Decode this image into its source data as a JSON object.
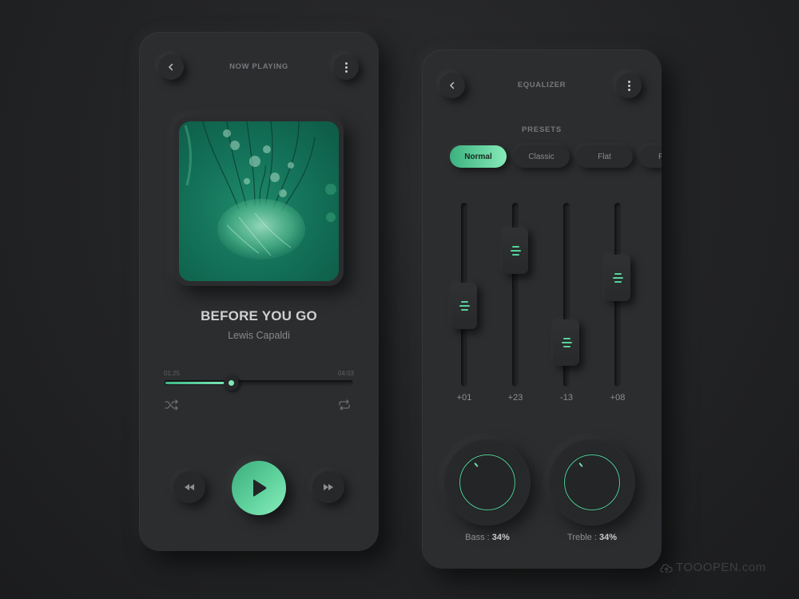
{
  "player": {
    "header_title": "NOW PLAYING",
    "back_icon": "chevron-left-icon",
    "menu_icon": "more-vertical-icon",
    "album_art": "jellyfish-album-art",
    "song_title": "BEFORE YOU GO",
    "artist": "Lewis Capaldi",
    "elapsed": "01:25",
    "duration": "04:03",
    "progress_fraction": 0.35,
    "shuffle_icon": "shuffle-icon",
    "repeat_icon": "repeat-icon",
    "controls": {
      "rewind_icon": "rewind-icon",
      "play_icon": "play-icon",
      "forward_icon": "fast-forward-icon"
    }
  },
  "equalizer": {
    "header_title": "EQUALIZER",
    "back_icon": "chevron-left-icon",
    "menu_icon": "more-vertical-icon",
    "presets_label": "PRESETS",
    "presets": [
      {
        "label": "Normal",
        "active": true
      },
      {
        "label": "Classic",
        "active": false
      },
      {
        "label": "Flat",
        "active": false
      },
      {
        "label": "P",
        "active": false
      }
    ],
    "bands": [
      {
        "value_label": "+01",
        "level": 0.44
      },
      {
        "value_label": "+23",
        "level": 0.74
      },
      {
        "value_label": "-13",
        "level": 0.24
      },
      {
        "value_label": "+08",
        "level": 0.59
      }
    ],
    "dials": [
      {
        "name": "Bass",
        "value": "34%"
      },
      {
        "name": "Treble",
        "value": "34%"
      }
    ],
    "separator": " : "
  },
  "colors": {
    "accent": "#5fd29d",
    "accent_light": "#86eab8",
    "panel": "#2c2d2f",
    "background": "#222325"
  },
  "watermark": "TOOOPEN.com"
}
